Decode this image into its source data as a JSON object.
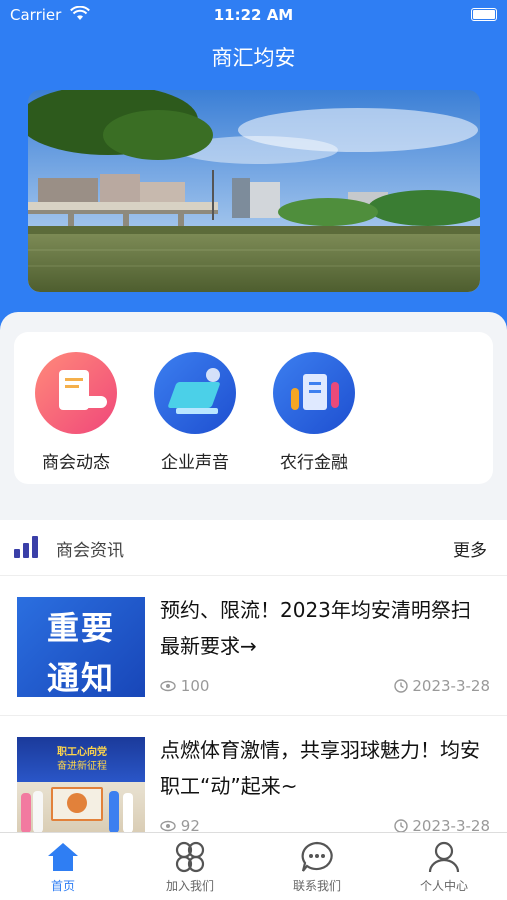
{
  "status": {
    "carrier": "Carrier",
    "time": "11:22 AM"
  },
  "header": {
    "title": "商汇均安"
  },
  "categories": [
    {
      "label": "商会动态",
      "icon": "chat-card-icon"
    },
    {
      "label": "企业声音",
      "icon": "laptop-icon"
    },
    {
      "label": "农行金融",
      "icon": "finance-people-icon"
    }
  ],
  "news": {
    "section_title": "商会资讯",
    "more_label": "更多",
    "items": [
      {
        "title": "预约、限流！2023年均安清明祭扫最新要求→",
        "thumb_text": [
          "重要",
          "通知"
        ],
        "views": "100",
        "date": "2023-3-28"
      },
      {
        "title": "点燃体育激情，共享羽球魅力！均安职工“动”起来~",
        "thumb_text": [
          "职工心向党",
          "奋进新征程"
        ],
        "views": "92",
        "date": "2023-3-28"
      }
    ]
  },
  "tabs": [
    {
      "label": "首页",
      "icon": "home-icon"
    },
    {
      "label": "加入我们",
      "icon": "grid-clover-icon"
    },
    {
      "label": "联系我们",
      "icon": "chat-bubble-icon"
    },
    {
      "label": "个人中心",
      "icon": "person-icon"
    }
  ],
  "colors": {
    "primary": "#2f7ef3",
    "bar_icon": "#3a3fa8"
  }
}
